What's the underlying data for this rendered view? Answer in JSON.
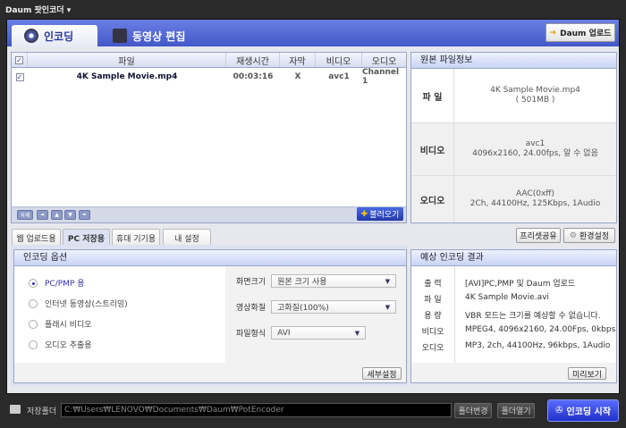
{
  "app": {
    "title": "Daum 팟인코더 ▾"
  },
  "main_tabs": [
    {
      "label": "인코딩"
    },
    {
      "label": "동영상 편집"
    }
  ],
  "daum_upload": "Daum 업로드",
  "file_list": {
    "columns": [
      "파일",
      "재생시간",
      "자막",
      "비디오",
      "오디오"
    ],
    "rows": [
      {
        "file": "4K Sample Movie.mp4",
        "duration": "00:03:16",
        "subtitle": "X",
        "video": "avc1",
        "audio": "Channel 1"
      }
    ],
    "delete_label": "삭제",
    "add_label": "불러오기"
  },
  "source_info": {
    "title": "원본 파일정보",
    "rows": [
      {
        "label": "파 일",
        "line1": "4K Sample Movie.mp4",
        "line2": "( 501MB )"
      },
      {
        "label": "비디오",
        "line1": "avc1",
        "line2": "4096x2160, 24.00fps, 알 수 없음"
      },
      {
        "label": "오디오",
        "line1": "AAC(0xff)",
        "line2": "2Ch, 44100Hz, 125Kbps, 1Audio"
      }
    ]
  },
  "preset_tabs": [
    "웹 업로드용",
    "PC 저장용",
    "휴대 기기용",
    "내 설정"
  ],
  "preset_share": "프리셋공유",
  "settings": "환경설정",
  "options": {
    "title": "인코딩 옵션",
    "radios": [
      "PC/PMP 용",
      "인터넷 동영상(스트리밍)",
      "플래시 비디오",
      "오디오 추출용"
    ],
    "fields": [
      {
        "label": "화면크기",
        "value": "원본 크기 사용"
      },
      {
        "label": "영상화질",
        "value": "고화질(100%)"
      },
      {
        "label": "파일형식",
        "value": "AVI"
      }
    ],
    "detail": "세부설정"
  },
  "result": {
    "title": "예상 인코딩 결과",
    "rows": [
      {
        "k": "출 력",
        "v": "[AVI]PC,PMP 및 Daum 업로드"
      },
      {
        "k": "파 일",
        "v": "4K Sample Movie.avi"
      },
      {
        "k": "용 량",
        "v": "VBR 모드는 크기를 예상할 수 없습니다."
      },
      {
        "k": "비디오",
        "v": "MPEG4, 4096x2160, 24.00Fps, 0kbps"
      },
      {
        "k": "오디오",
        "v": "MP3, 2ch, 44100Hz, 96kbps, 1Audio"
      }
    ],
    "preview": "미리보기"
  },
  "footer": {
    "folder_label": "저장폴더",
    "path": "C:₩Users₩LENOVO₩Documents₩Daum₩PotEncoder",
    "change": "폴더변경",
    "open": "폴더열기",
    "start": "인코딩 시작"
  }
}
